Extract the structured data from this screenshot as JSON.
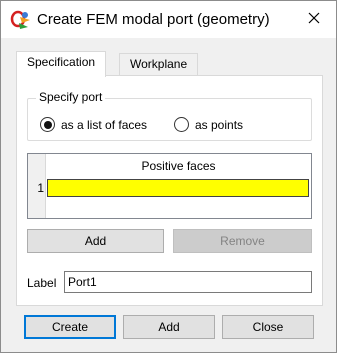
{
  "window": {
    "title": "Create FEM modal port (geometry)",
    "icon": "app-logo-icon",
    "close_icon": "close-icon"
  },
  "tabs": [
    {
      "label": "Specification",
      "active": true
    },
    {
      "label": "Workplane",
      "active": false
    }
  ],
  "specify_port": {
    "group_label": "Specify port",
    "options": [
      {
        "label": "as a list of faces",
        "selected": true
      },
      {
        "label": "as points",
        "selected": false
      }
    ]
  },
  "faces_table": {
    "column_header": "Positive faces",
    "rows": [
      {
        "index": "1",
        "value": ""
      }
    ],
    "highlight_color": "#ffff00"
  },
  "table_buttons": {
    "add_label": "Add",
    "remove_label": "Remove",
    "remove_enabled": false
  },
  "label_field": {
    "label": "Label",
    "value": "Port1"
  },
  "footer_buttons": {
    "create_label": "Create",
    "add_label": "Add",
    "close_label": "Close"
  }
}
